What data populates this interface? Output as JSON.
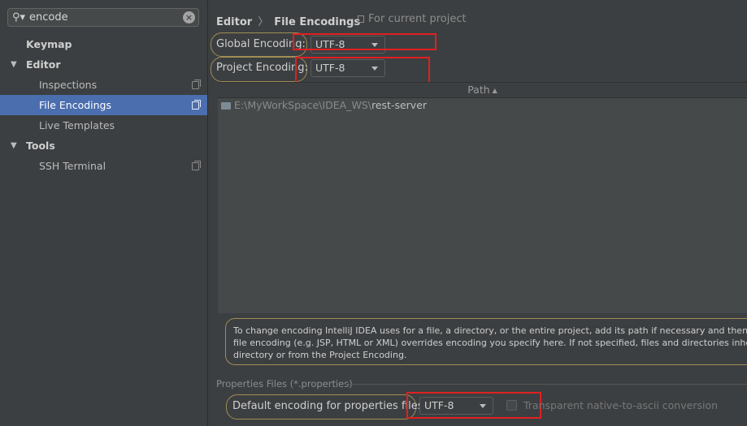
{
  "search": {
    "value": "encode",
    "icon": "search-icon",
    "clear_icon": "clear-icon"
  },
  "sidebar": {
    "items": [
      {
        "label": "Keymap",
        "level": 0,
        "expandable": false
      },
      {
        "label": "Editor",
        "level": 0,
        "expandable": true,
        "expanded": true
      },
      {
        "label": "Inspections",
        "level": 1,
        "has_project_icon": true
      },
      {
        "label": "File Encodings",
        "level": 1,
        "selected": true,
        "has_project_icon": true
      },
      {
        "label": "Live Templates",
        "level": 1
      },
      {
        "label": "Tools",
        "level": 0,
        "expandable": true,
        "expanded": true
      },
      {
        "label": "SSH Terminal",
        "level": 1,
        "has_project_icon": true
      }
    ],
    "arrow_glyph": "▼"
  },
  "header": {
    "breadcrumb": [
      "Editor",
      "File Encodings"
    ],
    "separator": "〉",
    "for_project": "For current project"
  },
  "encodings": {
    "global_label": "Global Encoding:",
    "global_value": "UTF-8",
    "project_label": "Project Encoding:",
    "project_value": "UTF-8"
  },
  "table": {
    "column": "Path",
    "sort_glyph": "▲",
    "rows": [
      {
        "path_prefix": "E:\\MyWorkSpace\\IDEA_WS\\",
        "path_name": "rest-server"
      }
    ]
  },
  "info_text": {
    "line1": "To change encoding IntelliJ IDEA uses for a file, a directory, or the entire project, add its path if necessary and then select",
    "line2": "file encoding (e.g. JSP, HTML or XML) overrides encoding you specify here. If not specified, files and directories inherit en",
    "line3": "directory or from the Project Encoding."
  },
  "properties": {
    "section_title": "Properties Files (*.properties)",
    "default_label": "Default encoding for properties files:",
    "default_value": "UTF-8",
    "transparent_label": "Transparent native-to-ascii conversion",
    "transparent_checked": false
  },
  "colors": {
    "background": "#3c3f41",
    "selection": "#4b6eaf",
    "highlight_red": "#e02020",
    "highlight_oval": "#a08d54"
  }
}
